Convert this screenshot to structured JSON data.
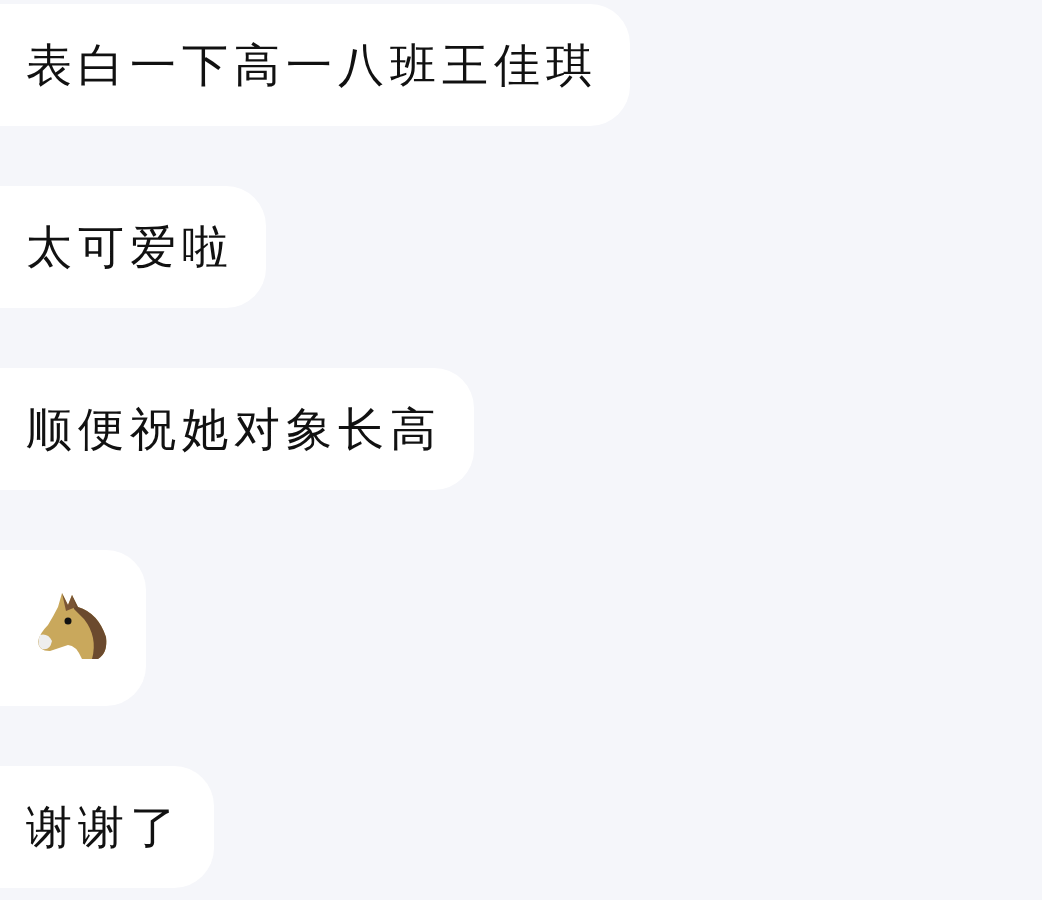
{
  "messages": [
    {
      "kind": "text",
      "text": "表白一下高一八班王佳琪"
    },
    {
      "kind": "text",
      "text": "太可爱啦"
    },
    {
      "kind": "text",
      "text": "顺便祝她对象长高"
    },
    {
      "kind": "sticker"
    },
    {
      "kind": "text",
      "text": "谢谢了"
    }
  ]
}
